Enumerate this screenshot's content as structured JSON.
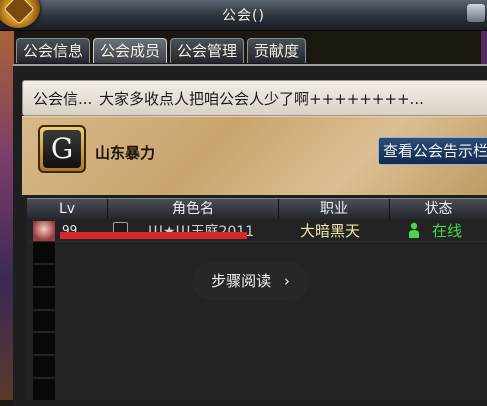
{
  "window": {
    "title": "公会()"
  },
  "tabs": [
    {
      "label": "公会信息",
      "active": false
    },
    {
      "label": "公会成员",
      "active": true
    },
    {
      "label": "公会管理",
      "active": false
    },
    {
      "label": "贡献度",
      "active": false
    }
  ],
  "notice": {
    "label": "公会信...",
    "text": "大家多收点人把咱公会人少了啊++++++++..."
  },
  "guild": {
    "badge_letter": "G",
    "name": "山东暴力",
    "view_notice_button": "查看公会告示栏"
  },
  "table": {
    "columns": [
      "Lv",
      "角色名",
      "职业",
      "状态"
    ],
    "rows": [
      {
        "lv": "99",
        "name": "Ш★Ш王庭2011",
        "class": "大暗黑天",
        "status": "在线"
      }
    ]
  },
  "overlay": {
    "steps_label": "步骤阅读",
    "chevron": "›"
  },
  "colors": {
    "online": "#46d84a",
    "class_text": "#f2e6a8",
    "redaction": "#d8262a"
  }
}
